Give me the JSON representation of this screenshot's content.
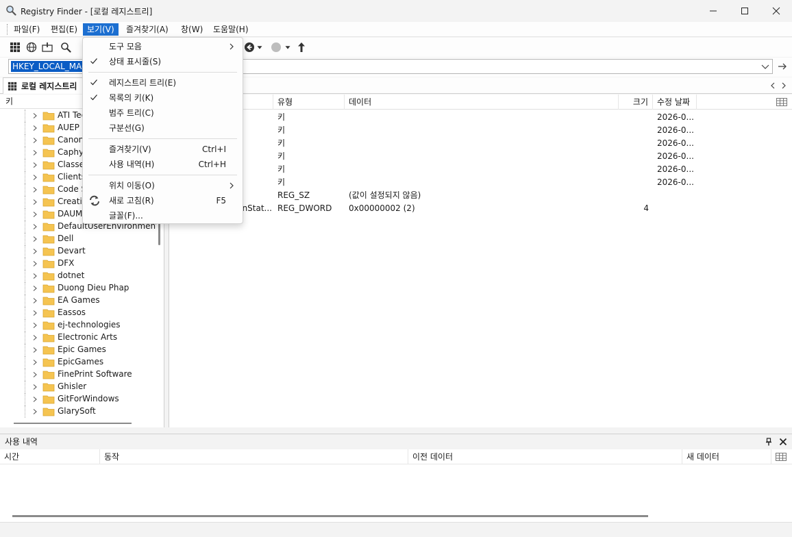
{
  "window": {
    "title": "Registry Finder - [로컬 레지스트리]"
  },
  "menubar": {
    "items": [
      "파일(F)",
      "편집(E)",
      "보기(V)",
      "즐겨찾기(A)",
      "창(W)",
      "도움말(H)"
    ],
    "active_index": 2
  },
  "address": {
    "value": "HKEY_LOCAL_MAC"
  },
  "tab": {
    "label": "로컬 레지스트리"
  },
  "tree": {
    "header": "키",
    "items": [
      "ATI Tec",
      "AUEP",
      "Canon",
      "Caphyo",
      "Classes",
      "Clients",
      "Code S",
      "Creative",
      "DAUM",
      "DefaultUserEnvironment",
      "Dell",
      "Devart",
      "DFX",
      "dotnet",
      "Duong Dieu Phap",
      "EA Games",
      "Eassos",
      "ej-technologies",
      "Electronic Arts",
      "Epic Games",
      "EpicGames",
      "FinePrint Software",
      "Ghisler",
      "GitForWindows",
      "GlarySoft"
    ]
  },
  "list": {
    "columns": {
      "type": "유형",
      "data": "데이터",
      "size": "크기",
      "modified": "수정 날짜"
    },
    "rows": [
      {
        "name": "",
        "type": "키",
        "data": "",
        "size": "",
        "modified": "2026-0..."
      },
      {
        "name": "",
        "type": "키",
        "data": "",
        "size": "",
        "modified": "2026-0..."
      },
      {
        "name": "",
        "type": "키",
        "data": "",
        "size": "",
        "modified": "2026-0..."
      },
      {
        "name": "",
        "type": "키",
        "data": "",
        "size": "",
        "modified": "2026-0..."
      },
      {
        "name": "",
        "type": "키",
        "data": "",
        "size": "",
        "modified": "2026-0..."
      },
      {
        "name": "",
        "type": "키",
        "data": "",
        "size": "",
        "modified": "2026-0..."
      },
      {
        "name": "",
        "type": "REG_SZ",
        "data": "(값이 설정되지 않음)",
        "size": "",
        "modified": ""
      },
      {
        "name": "wnStat...",
        "type": "REG_DWORD",
        "data": "0x00000002 (2)",
        "size": "4",
        "modified": ""
      }
    ]
  },
  "history": {
    "title": "사용 내역",
    "columns": {
      "time": "시간",
      "action": "동작",
      "old": "이전 데이터",
      "new": "새 데이터"
    }
  },
  "view_menu": {
    "items": [
      {
        "label": "도구 모음",
        "shortcut": "",
        "checked": false,
        "submenu": true
      },
      {
        "label": "상태 표시줄(S)",
        "shortcut": "",
        "checked": true,
        "submenu": false
      },
      {
        "label": "레지스트리 트리(E)",
        "shortcut": "",
        "checked": true,
        "submenu": false
      },
      {
        "label": "목록의 키(K)",
        "shortcut": "",
        "checked": true,
        "submenu": false
      },
      {
        "label": "범주 트리(C)",
        "shortcut": "",
        "checked": false,
        "submenu": false
      },
      {
        "label": "구분선(G)",
        "shortcut": "",
        "checked": false,
        "submenu": false
      },
      {
        "label": "즐겨찾기(V)",
        "shortcut": "Ctrl+I",
        "checked": false,
        "submenu": false
      },
      {
        "label": "사용 내역(H)",
        "shortcut": "Ctrl+H",
        "checked": false,
        "submenu": false
      },
      {
        "label": "위치 이동(O)",
        "shortcut": "",
        "checked": false,
        "submenu": true
      },
      {
        "label": "새로 고침(R)",
        "shortcut": "F5",
        "checked": false,
        "submenu": false,
        "icon": "refresh-icon"
      },
      {
        "label": "글꼴(F)...",
        "shortcut": "",
        "checked": false,
        "submenu": false
      }
    ]
  },
  "colors": {
    "accent": "#1c6fd1",
    "selection": "#0a5cc5",
    "folder": "#f5c451"
  }
}
